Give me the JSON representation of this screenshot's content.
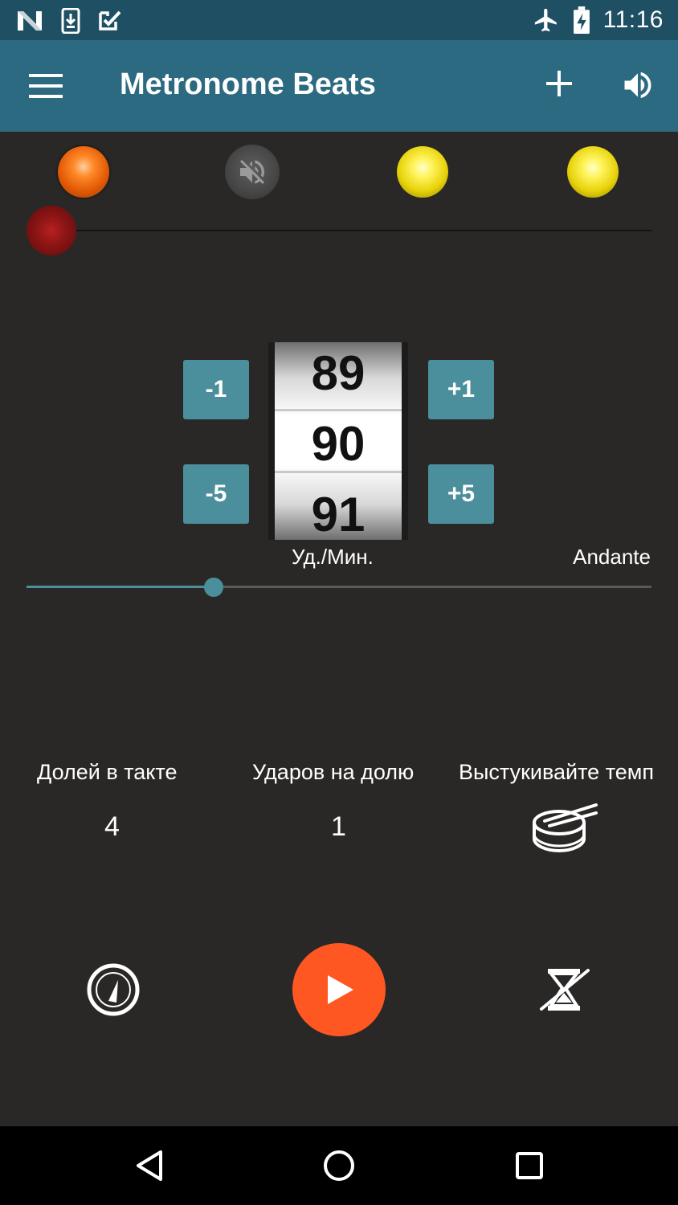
{
  "status_bar": {
    "time": "11:16",
    "left_icons": [
      "n-logo-icon",
      "download-icon",
      "check-icon"
    ],
    "right_icons": [
      "airplane-icon",
      "battery-charging-icon"
    ]
  },
  "app_bar": {
    "title": "Metronome Beats",
    "background": "#2b6a80"
  },
  "beat_lights": [
    {
      "state": "accent",
      "color": "#ff7a1a"
    },
    {
      "state": "muted",
      "icon": "volume-off-icon"
    },
    {
      "state": "normal",
      "color": "#f2e020"
    },
    {
      "state": "normal",
      "color": "#f2e020"
    }
  ],
  "tempo": {
    "minus1_label": "-1",
    "minus5_label": "-5",
    "plus1_label": "+1",
    "plus5_label": "+5",
    "prev": "89",
    "current": "90",
    "next": "91",
    "unit_label": "Уд./Мин.",
    "tempo_name": "Andante",
    "slider_level": 0.3
  },
  "settings": {
    "beats_per_bar_label": "Долей в такте",
    "beats_per_bar_value": "4",
    "clicks_per_beat_label": "Ударов на долю",
    "clicks_per_beat_value": "1",
    "tap_tempo_label": "Выстукивайте темп"
  },
  "controls": {
    "left_icon": "speedometer-icon",
    "play_icon": "play-icon",
    "right_icon": "timer-off-icon",
    "play_color": "#ff5722"
  },
  "nav_bar": {
    "icons": [
      "back-icon",
      "home-icon",
      "recents-icon"
    ]
  }
}
